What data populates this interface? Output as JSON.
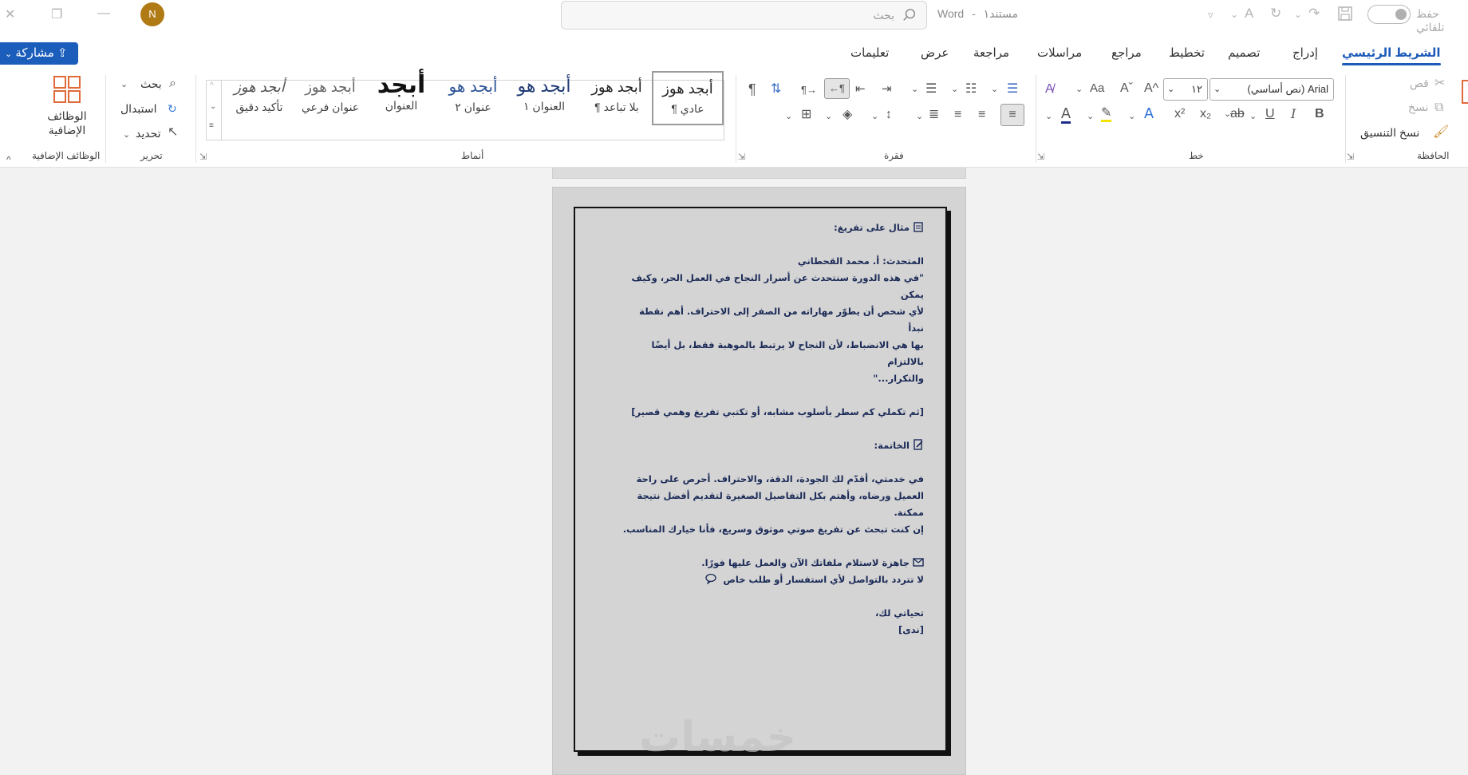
{
  "titlebar": {
    "close_glyph": "✕",
    "restore_glyph": "❐",
    "minimize_glyph": "—",
    "avatar_initial": "N",
    "search_placeholder": "بحث",
    "doc_name": "مستند١",
    "app_name": "Word",
    "autosave_label": "حفظ تلقائي"
  },
  "tabs": {
    "home": "الشريط الرئيسي",
    "insert": "إدراج",
    "design": "تصميم",
    "layout": "تخطيط",
    "references": "مراجع",
    "mailings": "مراسلات",
    "review": "مراجعة",
    "view": "عرض",
    "help": "تعليمات"
  },
  "share_button": "مشاركة",
  "ribbon": {
    "clipboard": {
      "label": "الحافظة",
      "cut": "قص",
      "copy": "نسخ",
      "format_painter": "نسخ التنسيق"
    },
    "font": {
      "label": "خط",
      "font_name": "Arial (نص أساسي)",
      "font_size": "١٢"
    },
    "paragraph": {
      "label": "فقرة"
    },
    "styles": {
      "label": "أنماط",
      "items": [
        {
          "sample": "أبجد هوز",
          "name": "¶ عادي"
        },
        {
          "sample": "أبجد هوز",
          "name": "¶ بلا تباعد"
        },
        {
          "sample": "أبجد هو",
          "name": "العنوان ١"
        },
        {
          "sample": "أبجد هو",
          "name": "عنوان ٢"
        },
        {
          "sample": "أبجد",
          "name": "العنوان"
        },
        {
          "sample": "أبجد هوز",
          "name": "عنوان فرعي"
        },
        {
          "sample": "أبجد هوز",
          "name": "تأكيد دقيق"
        }
      ]
    },
    "editing": {
      "label": "تحرير",
      "find": "بحث",
      "replace": "استبدال",
      "select": "تحديد"
    },
    "addins": {
      "label": "الوظائف الإضافية",
      "button": "الوظائف الإضافية"
    }
  },
  "document": {
    "heading1": "مثال على تفريغ:",
    "speaker": "المتحدث: أ. محمد القحطاني",
    "quote_l1": "\"في هذه الدورة سنتحدث عن أسرار النجاح في العمل الحر، وكيف يمكن",
    "quote_l2": "لأي شخص أن يطوّر مهاراته من الصفر إلى الاحتراف. أهم نقطة نبدأ",
    "quote_l3": "بها هي الانضباط، لأن النجاح لا يرتبط بالموهبة فقط، بل أيضًا بالالتزام",
    "quote_l4": "والتكرار...\"",
    "note": "[ثم تكملي كم سطر بأسلوب مشابه، أو تكتبي تفريغ وهمي قصير]",
    "heading2": "الخاتمة:",
    "closing_l1": "في خدمتي، أقدّم لك الجودة، الدقة، والاحتراف. أحرص على راحة",
    "closing_l2": "العميل ورضاه، وأهتم بكل التفاصيل الصغيرة لتقديم أفضل نتيجة ممكنة.",
    "closing_l3": "إن كنت تبحث عن تفريغ صوتي موثوق وسريع، فأنا خيارك المناسب.",
    "ready": "جاهزة لاستلام ملفاتك الآن والعمل عليها فورًا.",
    "contact": "لا تتردد بالتواصل لأي استفسار أو طلب خاص",
    "greeting": "تحياتي لك،",
    "signature": "[ندى]",
    "watermark": "خمسات"
  },
  "colors": {
    "accent": "#1e5bb8",
    "share": "#1a5dba",
    "avatar": "#b07a15",
    "doc_text": "#1b2a57",
    "page_bg": "#d4d4d4"
  }
}
